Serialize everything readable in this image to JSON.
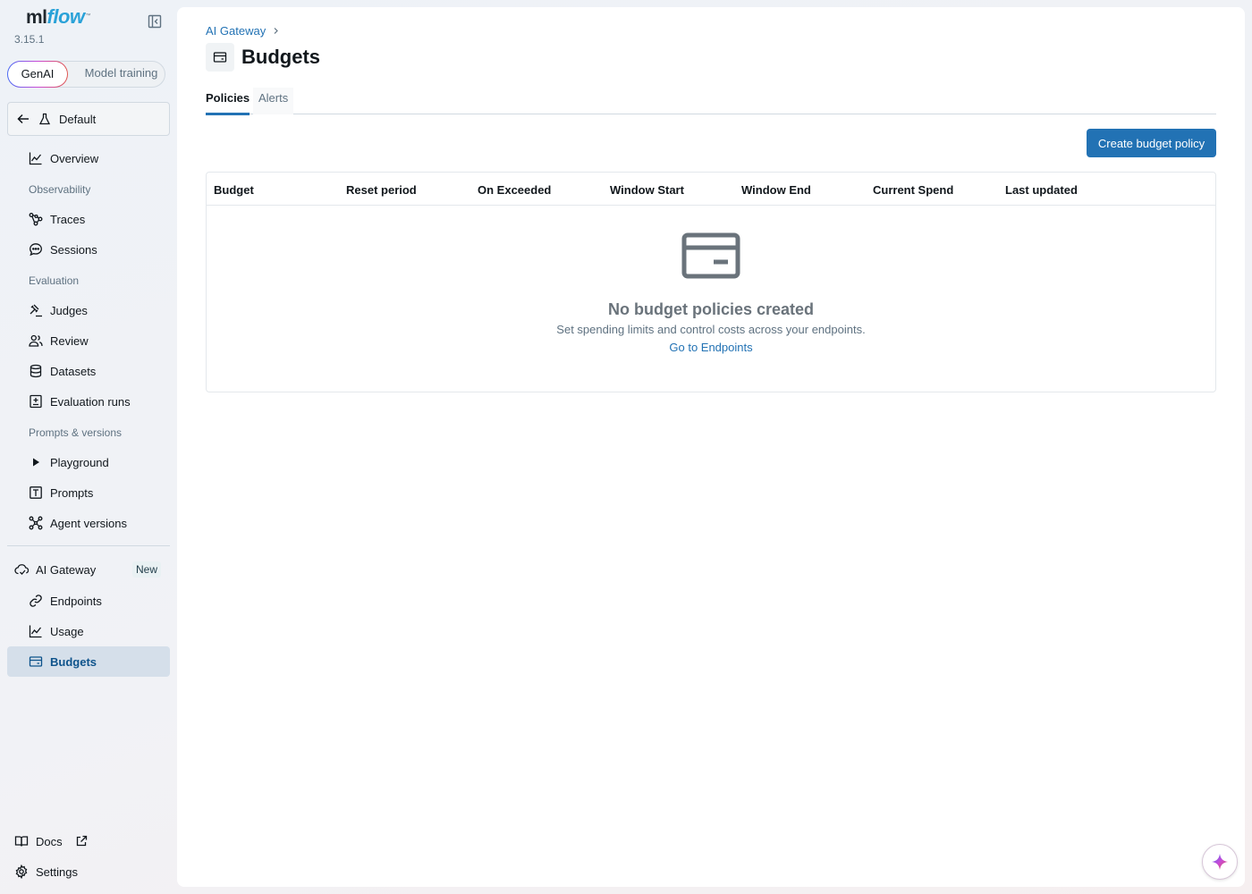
{
  "app": {
    "logo_ml": "ml",
    "logo_flow": "flow",
    "logo_tm": "™",
    "version": "3.15.1"
  },
  "mode_switch": {
    "active": "GenAI",
    "inactive": "Model training"
  },
  "workspace": {
    "label": "Default"
  },
  "sidebar": {
    "overview": "Overview",
    "observability_section": "Observability",
    "traces": "Traces",
    "sessions": "Sessions",
    "evaluation_section": "Evaluation",
    "judges": "Judges",
    "review": "Review",
    "datasets": "Datasets",
    "evaluation_runs": "Evaluation runs",
    "prompts_section": "Prompts & versions",
    "playground": "Playground",
    "prompts": "Prompts",
    "agent_versions": "Agent versions",
    "ai_gateway": "AI Gateway",
    "new_badge": "New",
    "endpoints": "Endpoints",
    "usage": "Usage",
    "budgets": "Budgets",
    "docs": "Docs",
    "settings": "Settings"
  },
  "page": {
    "breadcrumb": "AI Gateway",
    "title": "Budgets",
    "tabs": [
      "Policies",
      "Alerts"
    ],
    "create_button": "Create budget policy"
  },
  "table": {
    "columns": [
      "Budget",
      "Reset period",
      "On Exceeded",
      "Window Start",
      "Window End",
      "Current Spend",
      "Last updated"
    ]
  },
  "empty_state": {
    "title": "No budget policies created",
    "description": "Set spending limits and control costs across your endpoints.",
    "link": "Go to Endpoints"
  },
  "colors": {
    "primary": "#2272b4",
    "selected_nav_bg": "#d5dfea",
    "selected_nav_text": "#0e538b"
  },
  "icons": {
    "assistant": "sparkle-icon",
    "empty": "credit-card-icon"
  }
}
